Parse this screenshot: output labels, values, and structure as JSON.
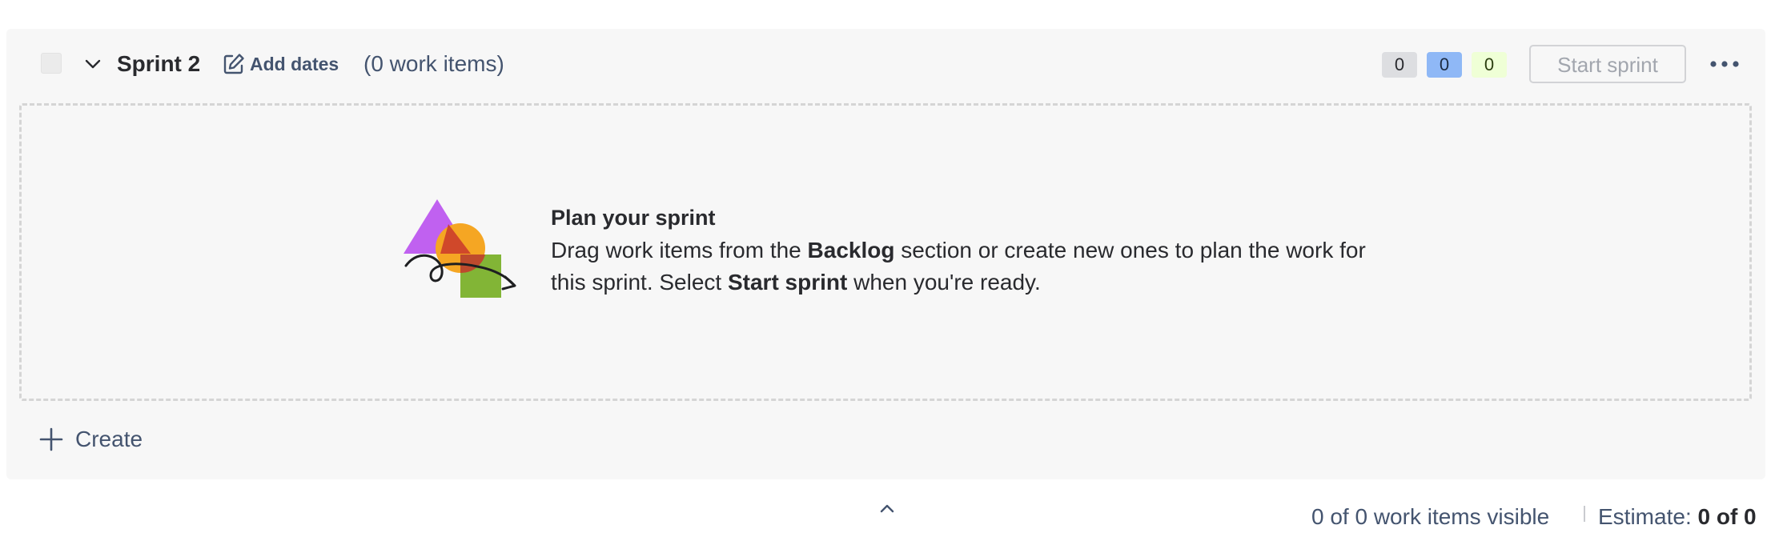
{
  "sprint": {
    "name": "Sprint 2",
    "add_dates_label": "Add dates",
    "work_items_count": "(0 work items)",
    "status_counts": {
      "todo": "0",
      "in_progress": "0",
      "done": "0"
    },
    "start_sprint_label": "Start sprint"
  },
  "empty_state": {
    "title": "Plan your sprint",
    "desc_part1": "Drag work items from the ",
    "desc_bold1": "Backlog",
    "desc_part2": " section or create new ones to plan the work for this sprint. Select ",
    "desc_bold2": "Start sprint",
    "desc_part3": " when you're ready."
  },
  "create_label": "Create",
  "footer": {
    "visible_text": "0 of 0 work items visible",
    "estimate_label": "Estimate",
    "estimate_value": "0 of 0"
  },
  "colors": {
    "card_bg": "#f7f7f7",
    "badge_gray": "#dddee1",
    "badge_blue": "#8fb8f6",
    "badge_green": "#efffd6",
    "illustration_purple": "#c061f0",
    "illustration_orange": "#f5a623",
    "illustration_red": "#c9372c",
    "illustration_green": "#82b536"
  },
  "icons": [
    "chevron-down-icon",
    "edit-icon",
    "more-icon",
    "plus-icon",
    "chevron-up-icon"
  ]
}
